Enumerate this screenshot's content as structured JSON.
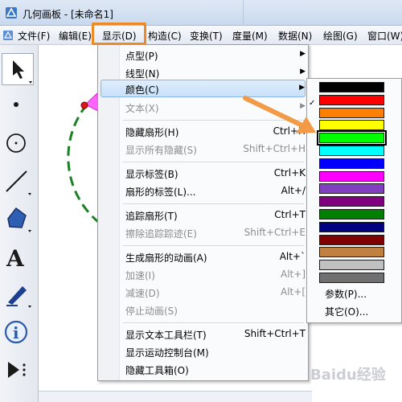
{
  "window": {
    "title": "几何画板 - [未命名1]"
  },
  "menubar": {
    "items": [
      "文件(F)",
      "编辑(E)",
      "显示(D)",
      "构造(C)",
      "变换(T)",
      "度量(M)",
      "数据(N)",
      "绘图(G)",
      "窗口(W)"
    ],
    "active": "显示(D)"
  },
  "toolbox": {
    "tools": [
      "arrow-tool",
      "point-tool",
      "compass-tool",
      "line-tool",
      "polygon-tool",
      "text-tool",
      "marker-tool",
      "info-tool",
      "custom-tool"
    ]
  },
  "display_menu": {
    "items": [
      {
        "label": "点型(P)",
        "submenu": true,
        "enabled": true
      },
      {
        "label": "线型(N)",
        "submenu": true,
        "enabled": true
      },
      {
        "label": "颜色(C)",
        "submenu": true,
        "enabled": true,
        "highlighted": true
      },
      {
        "label": "文本(X)",
        "submenu": true,
        "enabled": false
      },
      {
        "label": "隐藏扇形(H)",
        "shortcut": "Ctrl+H",
        "enabled": true
      },
      {
        "label": "显示所有隐藏(S)",
        "shortcut": "Shift+Ctrl+H",
        "enabled": false
      },
      {
        "label": "显示标签(B)",
        "shortcut": "Ctrl+K",
        "enabled": true
      },
      {
        "label": "扇形的标签(L)...",
        "shortcut": "Alt+/",
        "enabled": true
      },
      {
        "label": "追踪扇形(T)",
        "shortcut": "Ctrl+T",
        "enabled": true
      },
      {
        "label": "擦除追踪踪迹(E)",
        "shortcut": "Shift+Ctrl+E",
        "enabled": false
      },
      {
        "label": "生成扇形的动画(A)",
        "shortcut": "Alt+`",
        "enabled": true
      },
      {
        "label": "加速(I)",
        "shortcut": "Alt+]",
        "enabled": false
      },
      {
        "label": "减速(D)",
        "shortcut": "Alt+[",
        "enabled": false
      },
      {
        "label": "停止动画(S)",
        "enabled": false
      },
      {
        "label": "显示文本工具栏(T)",
        "shortcut": "Shift+Ctrl+T",
        "enabled": true
      },
      {
        "label": "显示运动控制台(M)",
        "enabled": true
      },
      {
        "label": "隐藏工具箱(O)",
        "enabled": true
      }
    ]
  },
  "color_submenu": {
    "swatches": [
      "#000000",
      "#ff0000",
      "#ff8000",
      "#ffff00",
      "#00ff00",
      "#00ffff",
      "#0000ff",
      "#ff00ff",
      "#8040c0",
      "#800080",
      "#008000",
      "#000080",
      "#800000",
      "#c08040",
      "#c0c0c0",
      "#707070"
    ],
    "selected_index": 4,
    "params_label": "参数(P)...",
    "other_label": "其它(O)..."
  },
  "colors": {
    "highlight_orange": "#ee8a26",
    "arrow_orange": "#f29a45",
    "arc_green": "#1b7f24",
    "fill_magenta": "#ff66ff"
  },
  "watermark": "Baidu经验"
}
